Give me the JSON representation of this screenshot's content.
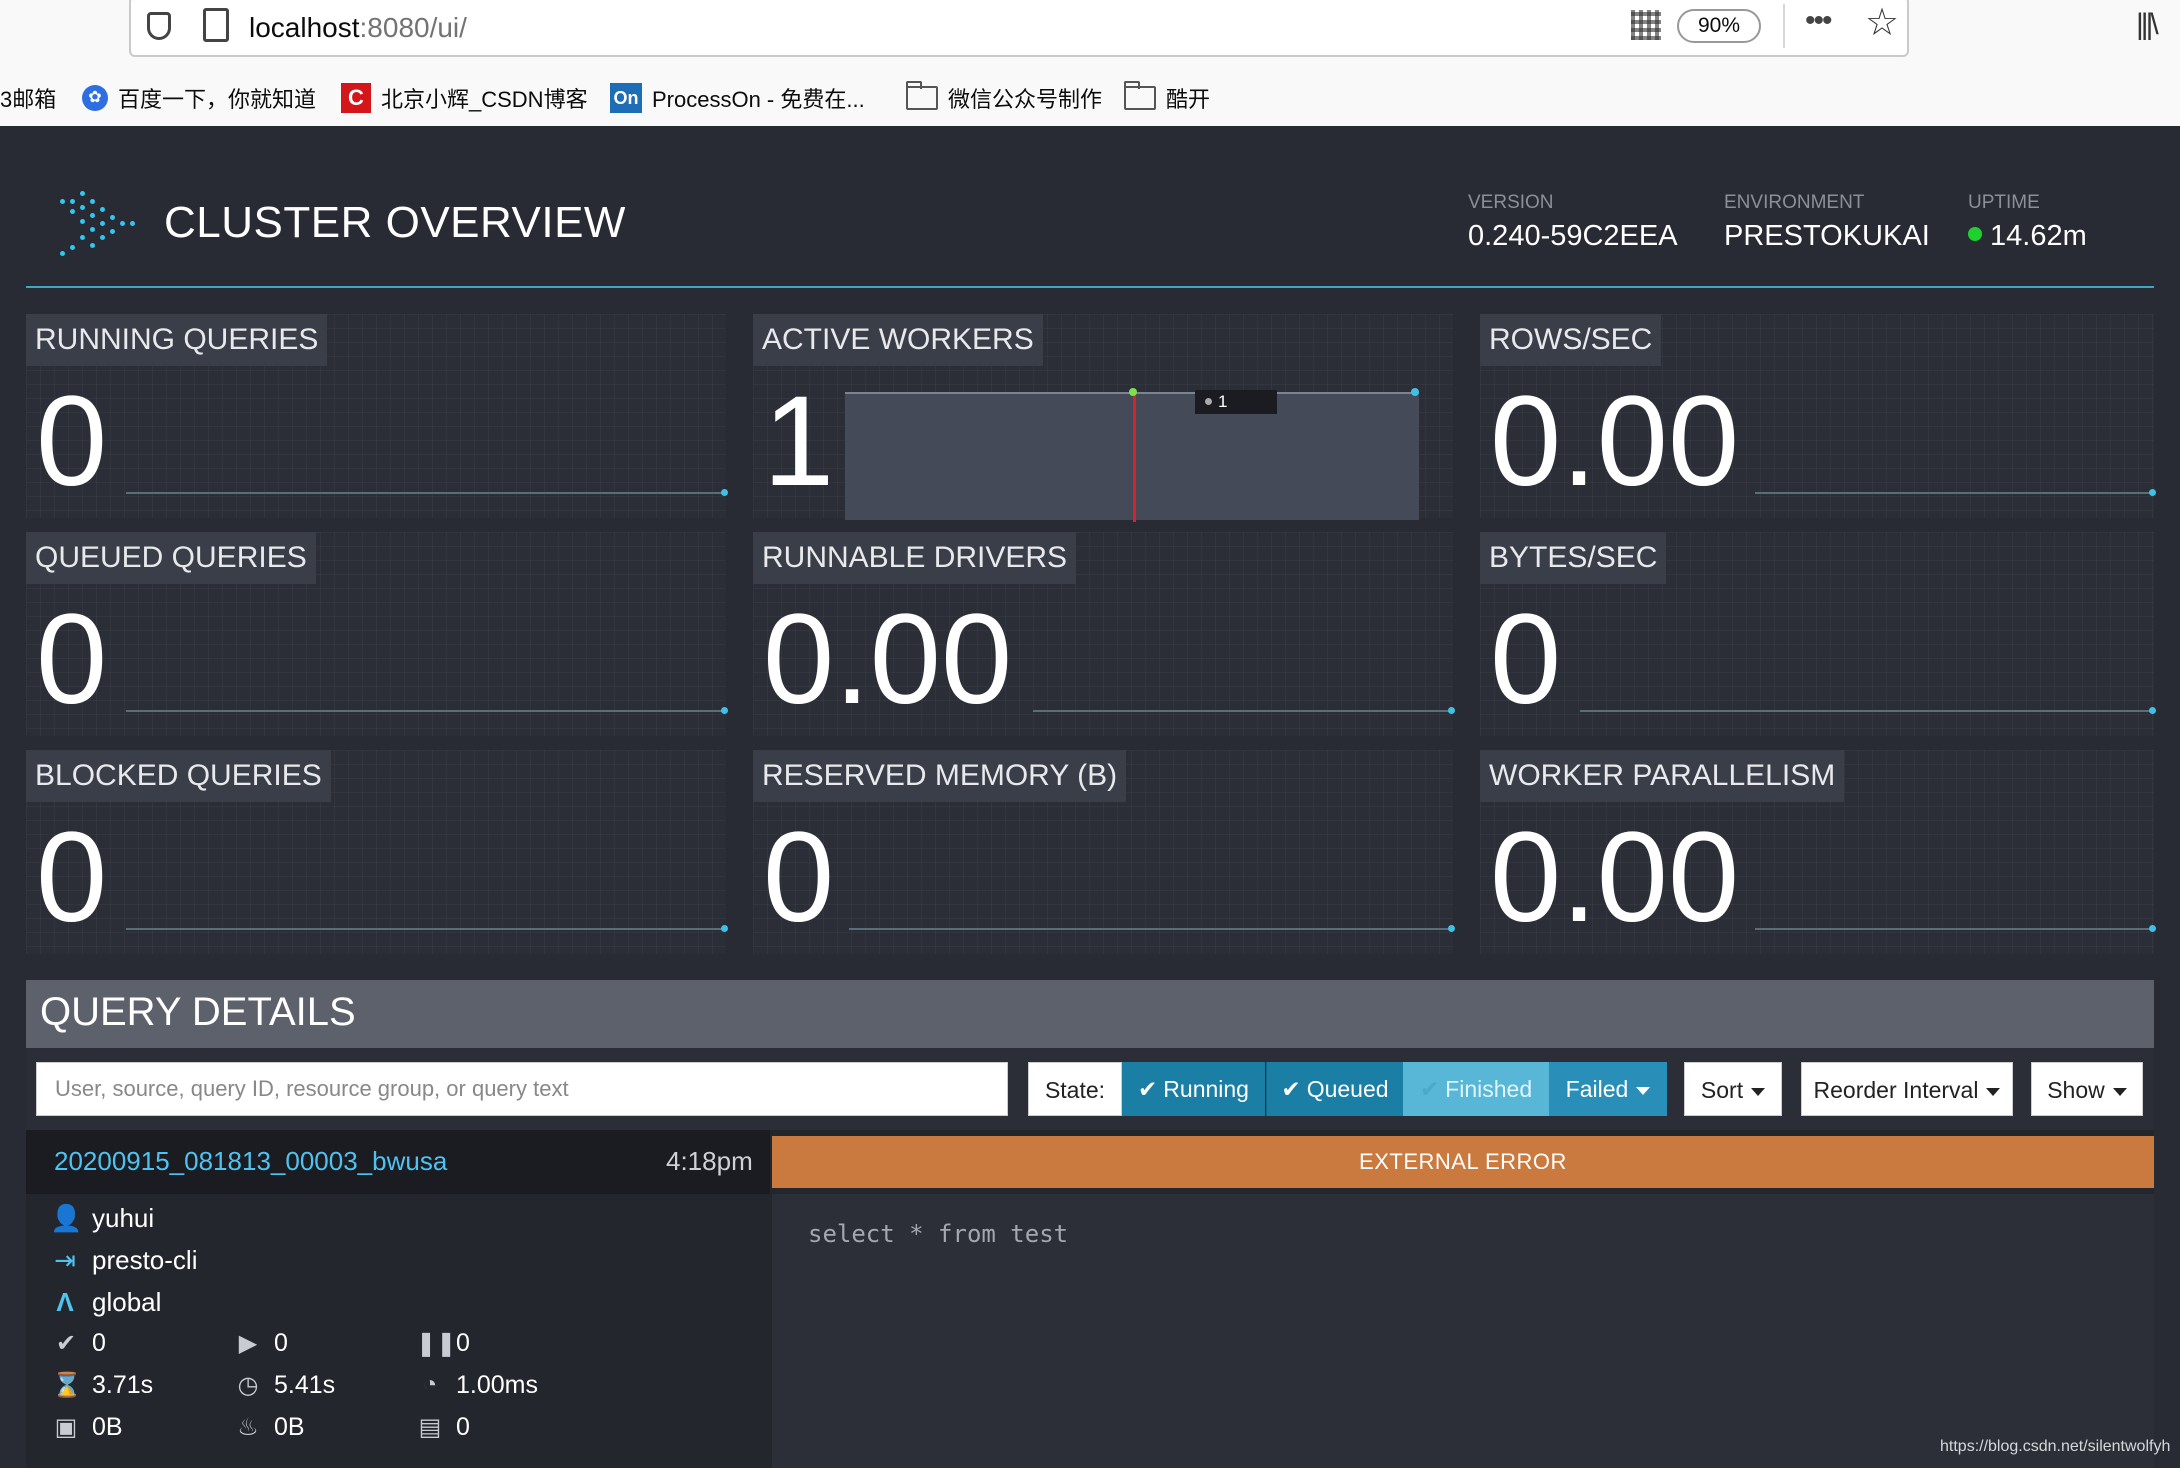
{
  "browser": {
    "url_host": "localhost",
    "url_path": ":8080/ui/",
    "zoom": "90%",
    "bookmarks": [
      {
        "label": "3邮箱",
        "icon": "none"
      },
      {
        "label": "百度一下，你就知道",
        "icon": "baidu-paw-icon"
      },
      {
        "label": "北京小辉_CSDN博客",
        "icon": "csdn-icon"
      },
      {
        "label": "ProcessOn - 免费在...",
        "icon": "processon-icon"
      },
      {
        "label": "微信公众号制作",
        "icon": "folder-icon"
      },
      {
        "label": "酷开",
        "icon": "folder-icon"
      }
    ],
    "csdn_glyph": "C",
    "on_glyph": "On"
  },
  "header": {
    "title": "CLUSTER OVERVIEW",
    "version_label": "VERSION",
    "version": "0.240-59C2EEA",
    "environment_label": "ENVIRONMENT",
    "environment": "PRESTOKUKAI",
    "uptime_label": "UPTIME",
    "uptime": "14.62m",
    "accent": "#3fa6c4",
    "uptime_dot_color": "#1ed12f"
  },
  "stats": {
    "running_queries": {
      "label": "RUNNING QUERIES",
      "value": "0"
    },
    "active_workers": {
      "label": "ACTIVE WORKERS",
      "value": "1",
      "tooltip": "1"
    },
    "rows_sec": {
      "label": "ROWS/SEC",
      "value": "0.00"
    },
    "queued_queries": {
      "label": "QUEUED QUERIES",
      "value": "0"
    },
    "runnable_drivers": {
      "label": "RUNNABLE DRIVERS",
      "value": "0.00"
    },
    "bytes_sec": {
      "label": "BYTES/SEC",
      "value": "0"
    },
    "blocked_queries": {
      "label": "BLOCKED QUERIES",
      "value": "0"
    },
    "reserved_memory": {
      "label": "RESERVED MEMORY (B)",
      "value": "0"
    },
    "worker_parallelism": {
      "label": "WORKER PARALLELISM",
      "value": "0.00"
    }
  },
  "query_details": {
    "title": "QUERY DETAILS",
    "search_placeholder": "User, source, query ID, resource group, or query text",
    "state_label": "State:",
    "filters": {
      "running": "Running",
      "queued": "Queued",
      "finished": "Finished",
      "failed": "Failed"
    },
    "sort": "Sort",
    "reorder": "Reorder Interval",
    "show": "Show",
    "query": {
      "id": "20200915_081813_00003_bwusa",
      "time": "4:18pm",
      "user": "yuhui",
      "source": "presto-cli",
      "resource_group": "global",
      "status": "EXTERNAL ERROR",
      "status_color": "#ca7a3f",
      "text": "select * from test",
      "completed_splits": "0",
      "running_splits": "0",
      "queued_splits": "0",
      "wall_time": "3.71s",
      "elapsed_time": "5.41s",
      "cpu_time": "1.00ms",
      "memory": "0B",
      "peak_memory": "0B",
      "cumulative": "0"
    }
  },
  "watermark": "https://blog.csdn.net/silentwolfyh"
}
